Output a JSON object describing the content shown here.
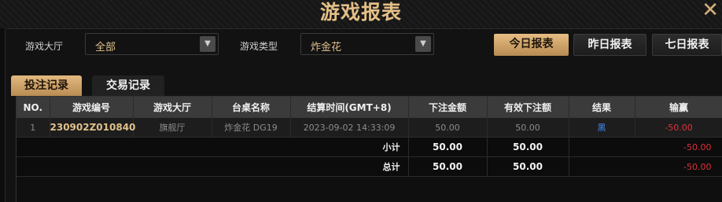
{
  "window": {
    "title": "游戏报表",
    "close_glyph": "✕"
  },
  "filters": {
    "hall_label": "游戏大厅",
    "hall_value": "全部",
    "type_label": "游戏类型",
    "type_value": "炸金花"
  },
  "report_buttons": {
    "today": "今日报表",
    "yesterday": "昨日报表",
    "seven_days": "七日报表"
  },
  "tabs": {
    "bets": "投注记录",
    "transactions": "交易记录"
  },
  "table": {
    "headers": {
      "no": "NO.",
      "game_id": "游戏编号",
      "hall": "游戏大厅",
      "table_name": "台桌名称",
      "settle_time": "结算时间(GMT+8)",
      "bet_amount": "下注金额",
      "valid_bet": "有效下注额",
      "result": "结果",
      "win_loss": "输赢"
    },
    "rows": [
      {
        "no": "1",
        "game_id": "230902Z010840",
        "hall": "旗舰厅",
        "table_name": "炸金花 DG19",
        "settle_time": "2023-09-02 14:33:09",
        "bet_amount": "50.00",
        "valid_bet": "50.00",
        "result": "黑",
        "win_loss": "-50.00"
      }
    ],
    "subtotal": {
      "label": "小计",
      "bet_amount": "50.00",
      "valid_bet": "50.00",
      "win_loss": "-50.00"
    },
    "total": {
      "label": "总计",
      "bet_amount": "50.00",
      "valid_bet": "50.00",
      "win_loss": "-50.00"
    }
  },
  "colors": {
    "accent_gold": "#e0c08c",
    "loss_red": "#e0303a",
    "result_blue": "#4a8cf0"
  }
}
